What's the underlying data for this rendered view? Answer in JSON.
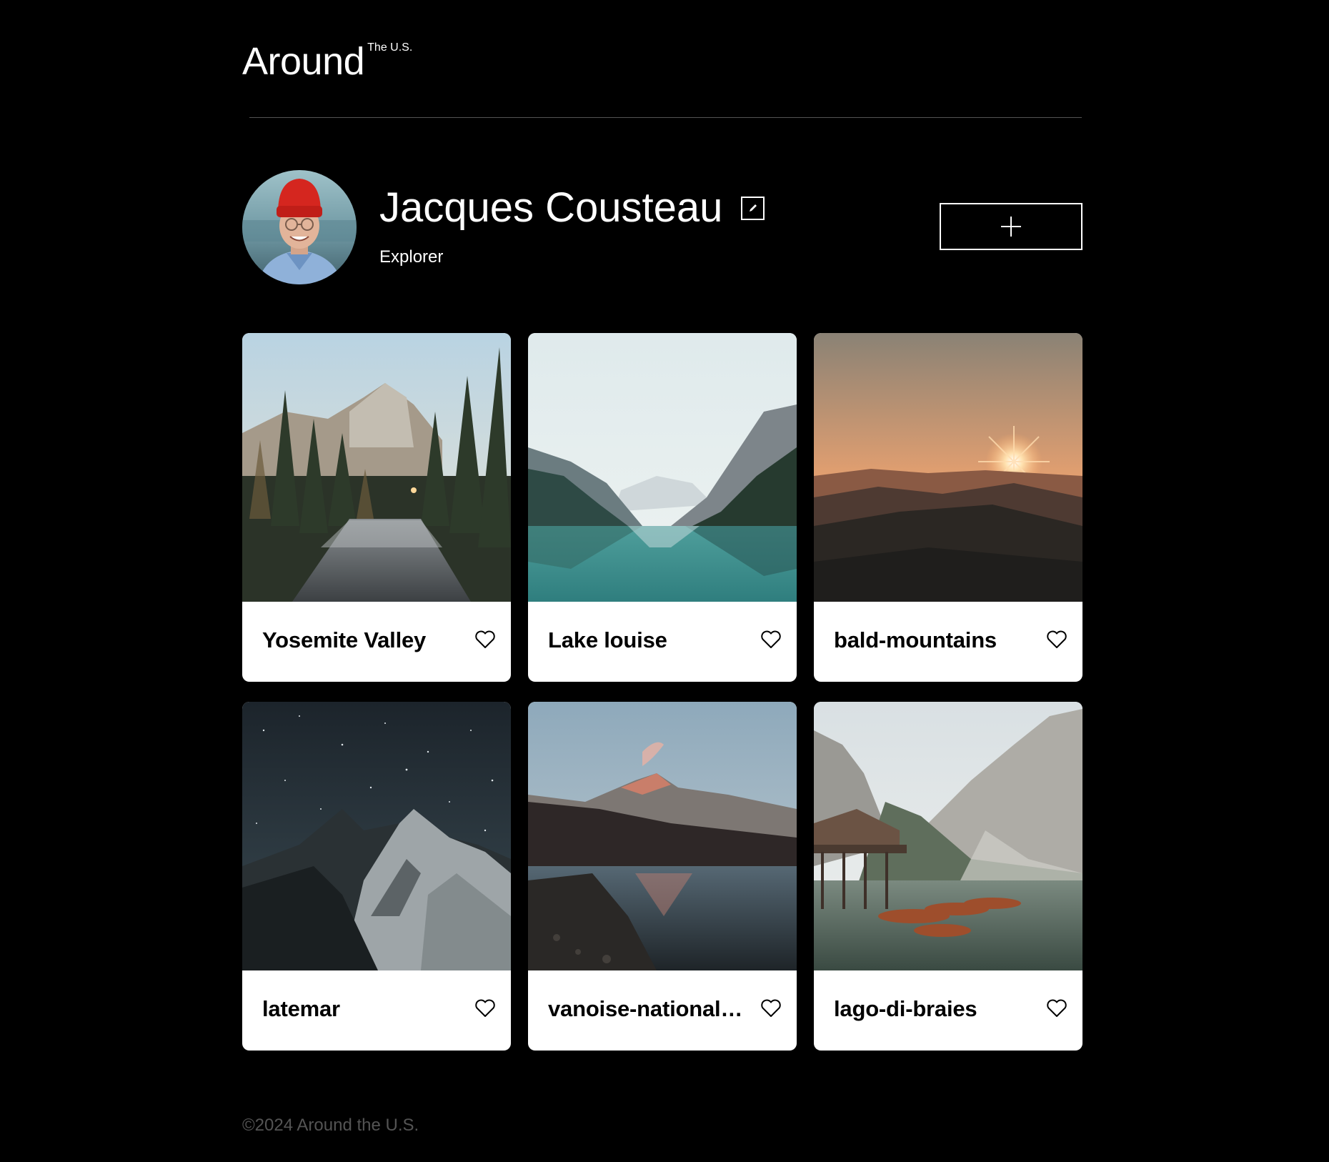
{
  "header": {
    "logo_main": "Around",
    "logo_sup": "The U.S."
  },
  "profile": {
    "name": "Jacques Cousteau",
    "job": "Explorer",
    "edit_icon": "pencil-icon",
    "add_icon": "plus-icon"
  },
  "cards": [
    {
      "title": "Yosemite Valley",
      "scene": "forest-river"
    },
    {
      "title": "Lake louise",
      "scene": "mountain-lake"
    },
    {
      "title": "bald-mountains",
      "scene": "sunset-hills"
    },
    {
      "title": "latemar",
      "scene": "night-peaks"
    },
    {
      "title": "vanoise-national-park",
      "scene": "reflection-lake"
    },
    {
      "title": "lago-di-braies",
      "scene": "boats-lake"
    }
  ],
  "footer": {
    "copyright": "©2024 Around the U.S."
  },
  "colors": {
    "background": "#000000",
    "card": "#ffffff",
    "divider": "#545454",
    "footer_text": "#545454"
  }
}
